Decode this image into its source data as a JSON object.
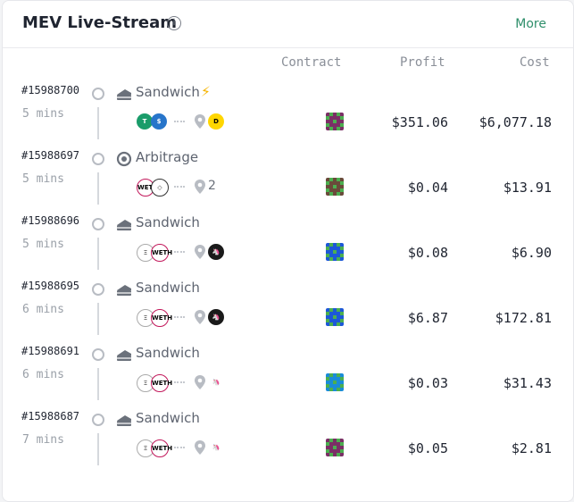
{
  "header": {
    "title": "MEV Live-Stream",
    "info_icon": "info-icon",
    "more_label": "More",
    "accent_color": "#2f8f6b"
  },
  "columns": {
    "contract": "Contract",
    "profit": "Profit",
    "cost": "Cost"
  },
  "rows": [
    {
      "block": "#15988700",
      "time": "5 mins",
      "type": "Sandwich",
      "type_icon": "cake-icon",
      "flash": true,
      "tokens": [
        "TUSD",
        "USDC"
      ],
      "venue_count": "",
      "venue_tokens": [
        "DODO"
      ],
      "contract_color": "#7b2f66",
      "profit": "$351.06",
      "cost": "$6,077.18"
    },
    {
      "block": "#15988697",
      "time": "5 mins",
      "type": "Arbitrage",
      "type_icon": "cycle-icon",
      "flash": false,
      "tokens": [
        "WETH",
        "CUBE"
      ],
      "venue_count": "2",
      "venue_tokens": [],
      "contract_color": "#6a4a3a",
      "profit": "$0.04",
      "cost": "$13.91"
    },
    {
      "block": "#15988696",
      "time": "5 mins",
      "type": "Sandwich",
      "type_icon": "cake-icon",
      "flash": false,
      "tokens": [
        "ETH",
        "WETH"
      ],
      "venue_count": "",
      "venue_tokens": [
        "UNI-V3"
      ],
      "contract_color": "#1d58d8",
      "profit": "$0.08",
      "cost": "$6.90"
    },
    {
      "block": "#15988695",
      "time": "6 mins",
      "type": "Sandwich",
      "type_icon": "cake-icon",
      "flash": false,
      "tokens": [
        "ETH",
        "WETH"
      ],
      "venue_count": "",
      "venue_tokens": [
        "UNI-V3"
      ],
      "contract_color": "#1d58d8",
      "profit": "$6.87",
      "cost": "$172.81"
    },
    {
      "block": "#15988691",
      "time": "6 mins",
      "type": "Sandwich",
      "type_icon": "cake-icon",
      "flash": false,
      "tokens": [
        "ETH",
        "WETH"
      ],
      "venue_count": "",
      "venue_tokens": [
        "UNISWAP"
      ],
      "contract_color": "#1a8cd8",
      "profit": "$0.03",
      "cost": "$31.43"
    },
    {
      "block": "#15988687",
      "time": "7 mins",
      "type": "Sandwich",
      "type_icon": "cake-icon",
      "flash": false,
      "tokens": [
        "ETH",
        "WETH"
      ],
      "venue_count": "",
      "venue_tokens": [
        "UNISWAP"
      ],
      "contract_color": "#7b2f66",
      "profit": "$0.05",
      "cost": "$2.81"
    }
  ]
}
